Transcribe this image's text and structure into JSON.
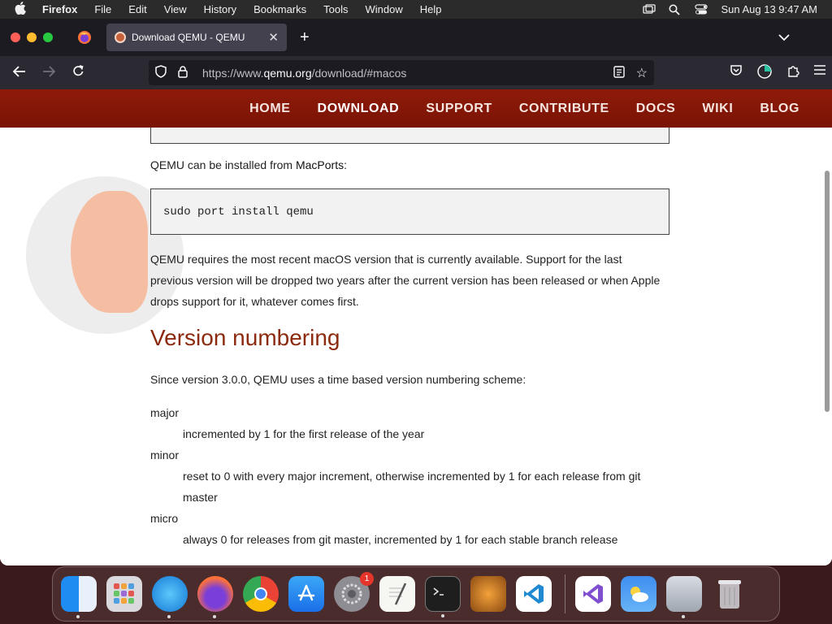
{
  "menubar": {
    "app_name": "Firefox",
    "items": [
      "File",
      "Edit",
      "View",
      "History",
      "Bookmarks",
      "Tools",
      "Window",
      "Help"
    ],
    "clock": "Sun Aug 13  9:47 AM"
  },
  "browser": {
    "tab_title": "Download QEMU - QEMU",
    "url_prefix": "https://www.",
    "url_domain": "qemu.org",
    "url_path": "/download/#macos"
  },
  "site_nav": {
    "items": [
      "HOME",
      "DOWNLOAD",
      "SUPPORT",
      "CONTRIBUTE",
      "DOCS",
      "WIKI",
      "BLOG"
    ],
    "active": "DOWNLOAD"
  },
  "content": {
    "macports_intro_pre": "QEMU can be installed from ",
    "macports_link": "MacPorts",
    "macports_intro_post": ":",
    "install_command": "sudo port install qemu",
    "macos_requirement": "QEMU requires the most recent macOS version that is currently available. Support for the last previous version will be dropped two years after the current version has been released or when Apple drops support for it, whatever comes first.",
    "section_heading": "Version numbering",
    "version_intro": "Since version 3.0.0, QEMU uses a time based version numbering scheme:",
    "definitions": [
      {
        "term": "major",
        "desc": "incremented by 1 for the first release of the year"
      },
      {
        "term": "minor",
        "desc": "reset to 0 with every major increment, otherwise incremented by 1 for each release from git master"
      },
      {
        "term": "micro",
        "desc": "always 0 for releases from git master, incremented by 1 for each stable branch release"
      }
    ]
  },
  "dock": {
    "apps": [
      "Finder",
      "Launchpad",
      "Safari",
      "Firefox",
      "Chrome",
      "App Store",
      "System Settings",
      "TextEdit",
      "Terminal",
      "GarageBand",
      "Visual Studio Code",
      "Visual Studio",
      "Weather",
      "Archive Utility",
      "Trash"
    ],
    "system_settings_badge": "1"
  },
  "colors": {
    "site_nav_bg": "#8e1b0a",
    "heading": "#8b2a0e"
  }
}
